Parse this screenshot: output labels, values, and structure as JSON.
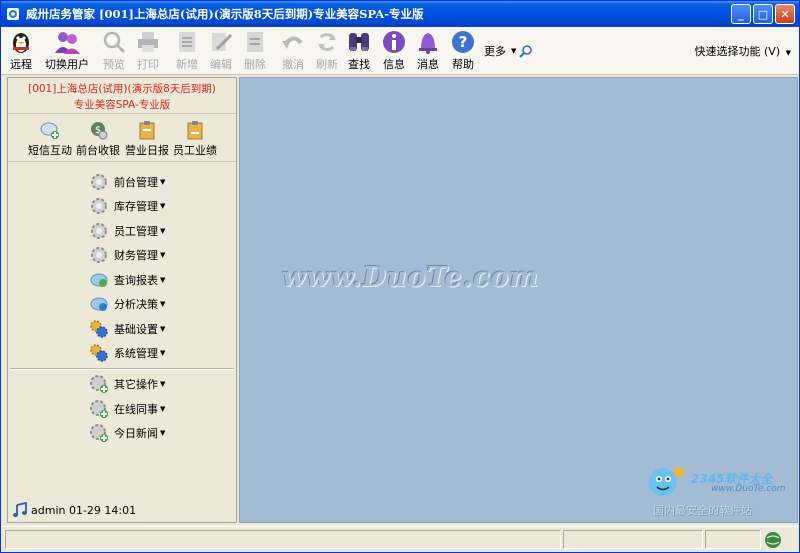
{
  "window": {
    "title": "威卅店务管家    [001]上海总店(试用)(演示版8天后到期)专业美容SPA-专业版",
    "controls": {
      "minimize": "_",
      "maximize": "□",
      "close": "✕"
    }
  },
  "toolbar": {
    "items": [
      {
        "label": "远程",
        "icon": "qq-penguin-icon",
        "enabled": true
      },
      {
        "label": "切换用户",
        "icon": "switch-user-icon",
        "enabled": true
      },
      {
        "label": "预览",
        "icon": "preview-magnifier-icon",
        "enabled": false
      },
      {
        "label": "打印",
        "icon": "printer-icon",
        "enabled": false
      },
      {
        "label": "新增",
        "icon": "add-document-icon",
        "enabled": false
      },
      {
        "label": "编辑",
        "icon": "edit-document-icon",
        "enabled": false
      },
      {
        "label": "删除",
        "icon": "delete-document-icon",
        "enabled": false
      },
      {
        "label": "撤消",
        "icon": "undo-icon",
        "enabled": false
      },
      {
        "label": "刷新",
        "icon": "refresh-icon",
        "enabled": false
      },
      {
        "label": "查找",
        "icon": "binoculars-icon",
        "enabled": true
      },
      {
        "label": "信息",
        "icon": "info-icon",
        "enabled": true
      },
      {
        "label": "消息",
        "icon": "bell-icon",
        "enabled": true
      },
      {
        "label": "帮助",
        "icon": "help-icon",
        "enabled": true
      }
    ],
    "more_label": "更多",
    "quick_label": "快速选择功能 (V)"
  },
  "left_panel": {
    "shop_name_line1": "[001]上海总店(试用)(演示版8天后到期)",
    "shop_name_line2": "专业美容SPA-专业版",
    "shortcuts": [
      {
        "label": "短信互动",
        "icon": "sms-icon"
      },
      {
        "label": "前台收银",
        "icon": "cashier-icon"
      },
      {
        "label": "营业日报",
        "icon": "daily-report-icon"
      },
      {
        "label": "员工业绩",
        "icon": "staff-performance-icon"
      }
    ],
    "menu_group1": [
      {
        "label": "前台管理",
        "icon": "gear-icon"
      },
      {
        "label": "库存管理",
        "icon": "gear-icon"
      },
      {
        "label": "员工管理",
        "icon": "gear-icon"
      },
      {
        "label": "财务管理",
        "icon": "gear-icon"
      },
      {
        "label": "查询报表",
        "icon": "report-search-icon"
      },
      {
        "label": "分析决策",
        "icon": "analysis-icon"
      },
      {
        "label": "基础设置",
        "icon": "settings-gears-icon"
      },
      {
        "label": "系统管理",
        "icon": "system-gears-icon"
      }
    ],
    "menu_group2": [
      {
        "label": "其它操作",
        "icon": "gear-plus-icon"
      },
      {
        "label": "在线同事",
        "icon": "gear-plus-icon"
      },
      {
        "label": "今日新闻",
        "icon": "gear-plus-icon"
      }
    ],
    "user_status": "admin 01-29 14:01"
  },
  "main": {
    "watermark": "www.DuoTe.com",
    "corner_logo": "2345软件大全",
    "corner_url": "www.DuoTe.com",
    "corner_slogan": "国内最安全的软件站"
  },
  "colors": {
    "titlebar": "#0055e5",
    "main_bg": "#a3bcd3",
    "shop_name": "#d6261b",
    "panel_bg": "#ece9d8"
  }
}
